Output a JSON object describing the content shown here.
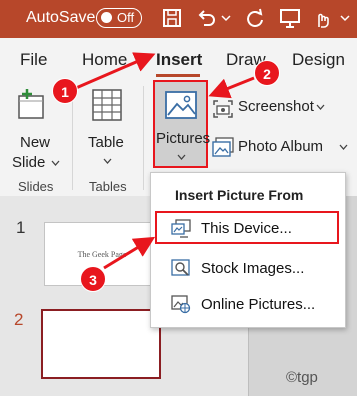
{
  "titlebar": {
    "autosave_label": "AutoSave",
    "autosave_state": "Off",
    "icons": [
      "save-icon",
      "undo-icon",
      "redo-icon",
      "present-icon",
      "touch-mode-icon"
    ]
  },
  "tabs": [
    "File",
    "Home",
    "Insert",
    "Draw",
    "Design"
  ],
  "active_tab": "Insert",
  "ribbon": {
    "new_slide": [
      "New",
      "Slide"
    ],
    "table": "Table",
    "pictures": "Pictures",
    "screenshot": "Screenshot",
    "photo_album": "Photo Album",
    "groups": [
      "Slides",
      "Tables"
    ]
  },
  "dropdown": {
    "header": "Insert Picture From",
    "items": [
      "This Device...",
      "Stock Images...",
      "Online Pictures..."
    ]
  },
  "slides": {
    "numbers": [
      "1",
      "2"
    ],
    "thumb_title": "The Geek Page"
  },
  "steps": [
    "1",
    "2",
    "3"
  ],
  "watermark": "©tgp",
  "colors": {
    "accent": "#b7472a",
    "annotation": "#e8161d",
    "selected_slide_border": "#8b1e22"
  }
}
